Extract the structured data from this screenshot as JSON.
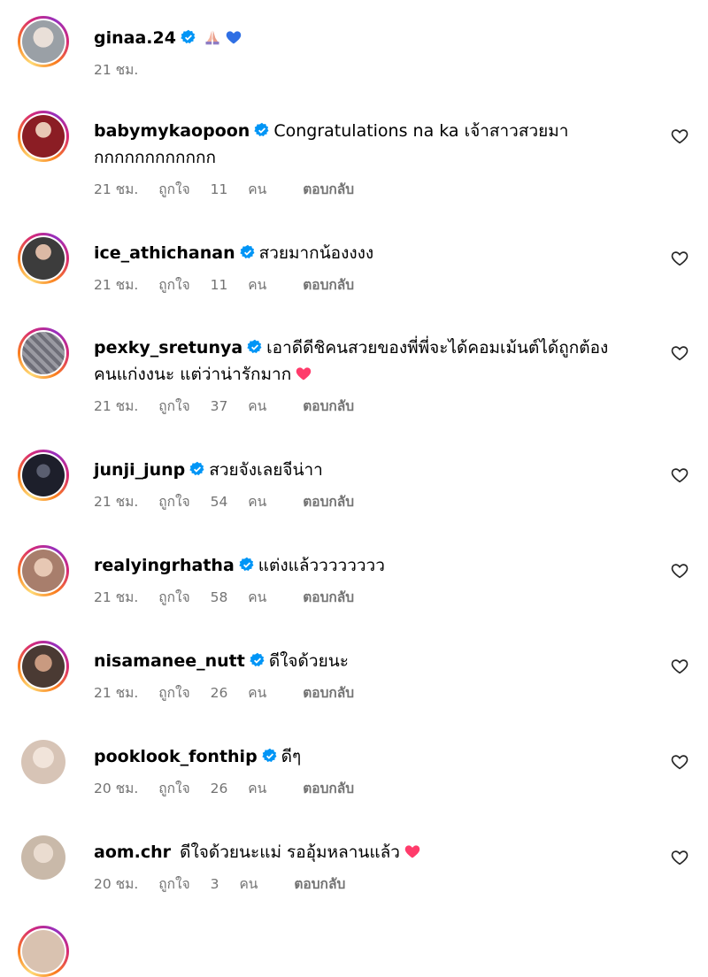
{
  "labels": {
    "like_prefix": "ถูกใจ",
    "like_suffix": "คน",
    "reply": "ตอบกลับ"
  },
  "comments": [
    {
      "username": "ginaa.24",
      "text": "",
      "emoji": [
        "praying-hands",
        "blue-heart"
      ],
      "time": "21 ชม.",
      "likes": "",
      "avatar_color": "#9aa0a6"
    },
    {
      "username": "babymykaopoon",
      "text": "Congratulations na ka เจ้าสาวสวยมา",
      "text2": "กกกกกกกกกกกก",
      "time": "21 ชม.",
      "likes": "11",
      "avatar_color": "#8b1d24"
    },
    {
      "username": "ice_athichanan",
      "text": "สวยมากน้องงงง",
      "time": "21 ชม.",
      "likes": "11",
      "avatar_color": "#3c3c3c"
    },
    {
      "username": "pexky_sretunya",
      "text": "เอาดีดีชิคนสวยของพี่พี่จะได้คอมเม้นต์ได้ถูกต้อง",
      "text2": "คนแก่งงนะ แต่ว่าน่ารักมาก",
      "emoji": [
        "pink-heart"
      ],
      "time": "21 ชม.",
      "likes": "37",
      "avatar_color": "#7d7d85"
    },
    {
      "username": "junji_junp",
      "text": "สวยจังเลยจีน่าา",
      "time": "21 ชม.",
      "likes": "54",
      "avatar_color": "#1d1f2b"
    },
    {
      "username": "realyingrhatha",
      "text": "แต่งแล้วววววววว",
      "time": "21 ชม.",
      "likes": "58",
      "avatar_color": "#a87e6c"
    },
    {
      "username": "nisamanee_nutt",
      "text": "ดีใจด้วยนะ",
      "time": "21 ชม.",
      "likes": "26",
      "avatar_color": "#4a3a33"
    },
    {
      "username": "pooklook_fonthip",
      "text": "ดีๆ",
      "time": "20 ชม.",
      "likes": "26",
      "avatar_color": "#d7c4b6"
    },
    {
      "username": "aom.chr",
      "text": "ดีใจด้วยนะแม่ รออุ้มหลานแล้ว",
      "emoji": [
        "pink-heart"
      ],
      "time": "20 ชม.",
      "likes": "3",
      "avatar_color": "#c9b9a9"
    }
  ],
  "colors": {
    "verified": "#0095f6",
    "meta_text": "#737373",
    "heart_pink": "#ff3b6b",
    "heart_blue": "#2f6fe4"
  }
}
